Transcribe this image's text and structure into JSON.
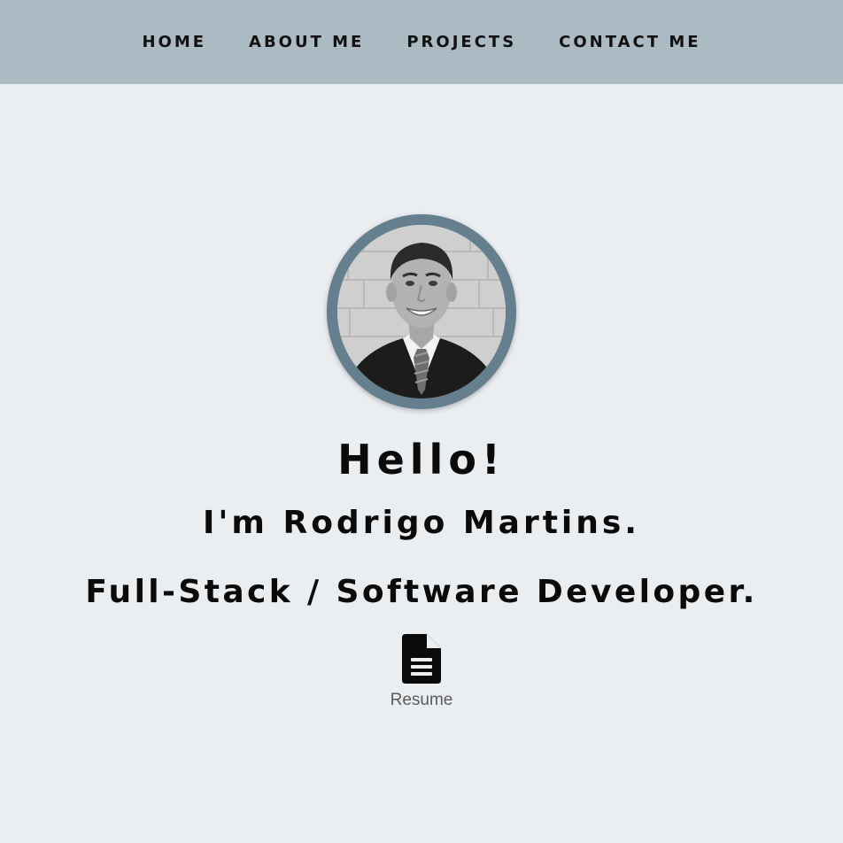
{
  "nav": {
    "items": [
      {
        "label": "HOME"
      },
      {
        "label": "ABOUT ME"
      },
      {
        "label": "PROJECTS"
      },
      {
        "label": "CONTACT ME"
      }
    ]
  },
  "hero": {
    "greeting": "Hello!",
    "name_line": "I'm Rodrigo Martins.",
    "role_line": "Full-Stack / Software Developer.",
    "avatar_icon": "profile-photo",
    "resume": {
      "icon": "document-icon",
      "label": "Resume"
    }
  },
  "colors": {
    "nav_background": "#acbbc3",
    "page_background": "#ebeef1",
    "avatar_ring": "#667f8f",
    "text": "#0a0a0a",
    "resume_label": "#5a5a5a"
  }
}
